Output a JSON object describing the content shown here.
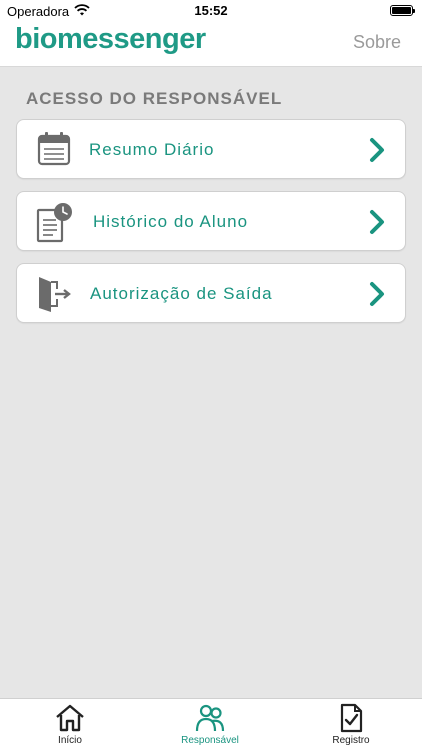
{
  "status_bar": {
    "carrier": "Operadora",
    "time": "15:52"
  },
  "nav_bar": {
    "logo": "biomessenger",
    "action_label": "Sobre"
  },
  "section": {
    "title": "ACESSO DO RESPONSÁVEL"
  },
  "menu": {
    "items": [
      {
        "label": "Resumo Diário",
        "icon": "calendar-icon"
      },
      {
        "label": "Histórico do Aluno",
        "icon": "document-clock-icon"
      },
      {
        "label": "Autorização de Saída",
        "icon": "exit-door-icon"
      }
    ]
  },
  "tab_bar": {
    "tabs": [
      {
        "label": "Início",
        "icon": "home-icon",
        "active": false
      },
      {
        "label": "Responsável",
        "icon": "people-icon",
        "active": true
      },
      {
        "label": "Registro",
        "icon": "document-check-icon",
        "active": false
      }
    ]
  },
  "colors": {
    "accent": "#1a9480",
    "icon_gray": "#6b6b6b",
    "background": "#e6e6e6"
  }
}
